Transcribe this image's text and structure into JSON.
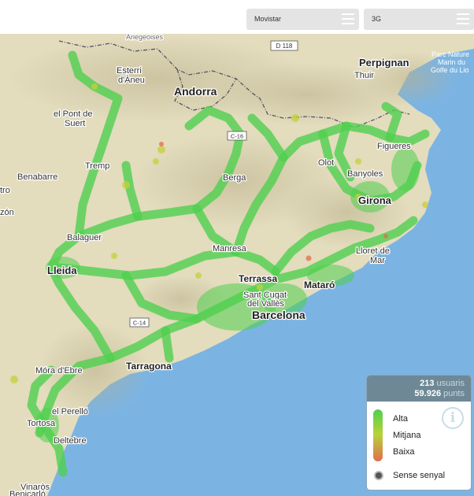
{
  "toolbar": {
    "operator": "Movistar",
    "network": "3G",
    "operator_menu_icon": "hamburger-icon",
    "network_menu_icon": "hamburger-icon"
  },
  "map": {
    "places": {
      "ariegeoises": "Ariegeoises",
      "esterri": "Esterri",
      "daneu": "d'Àneu",
      "andorra": "Andorra",
      "perpignan": "Perpignan",
      "thuir": "Thuir",
      "parc1": "Parc Nature",
      "parc2": "Marin du",
      "parc3": "Golfe du Lio",
      "pont1": "el Pont de",
      "pont2": "Suert",
      "figueres": "Figueres",
      "tremp": "Tremp",
      "benabarre": "Benabarre",
      "tro": "tro",
      "berga": "Berga",
      "olot": "Olot",
      "banyoles": "Banyoles",
      "girona": "Girona",
      "zon": "zón",
      "balaguer": "Balaguer",
      "manresa": "Manresa",
      "lloret1": "Lloret de",
      "lloret2": "Mar",
      "lleida": "Lleida",
      "terrassa": "Terrassa",
      "mataro": "Mataró",
      "santcugat1": "Sant Cugat",
      "santcugat2": "del Vallès",
      "barcelona": "Barcelona",
      "mora": "Móra d'Ebre",
      "tarragona": "Tarragona",
      "perello": "el Perelló",
      "tortosa": "Tortosa",
      "deltebre": "Deltebre",
      "vinaros": "Vinaròs",
      "benicarlo": "Benicarló"
    },
    "roads": {
      "d118": "D 118",
      "c16": "C-16",
      "c14": "C-14"
    },
    "colors": {
      "sea": "#7bb4e3",
      "land": "#e3dcbd",
      "coverage_high": "#4fd04f",
      "coverage_medium": "#c8cf3a",
      "coverage_low": "#e26d4c",
      "border": "#555566"
    }
  },
  "legend": {
    "users_count": "213",
    "users_label": "usuaris",
    "points_count": "59.926",
    "points_label": "punts",
    "high": "Alta",
    "medium": "Mitjana",
    "low": "Baixa",
    "no_signal": "Sense senyal",
    "info_glyph": "i"
  }
}
